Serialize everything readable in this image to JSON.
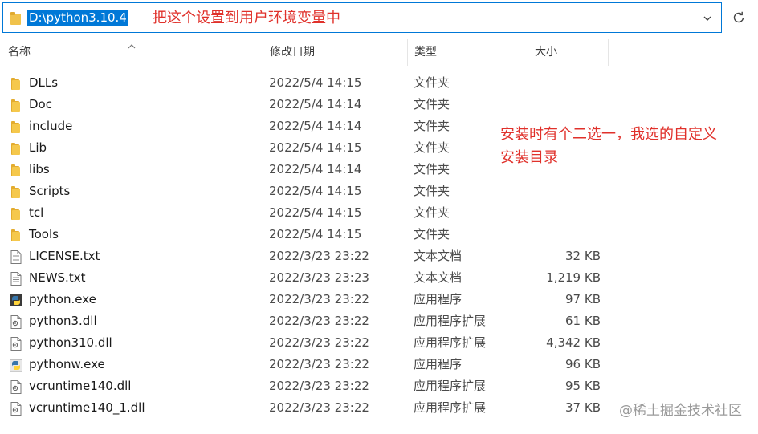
{
  "address": {
    "path": "D:\\python3.10.4"
  },
  "annotations": {
    "top": "把这个设置到用户环境变量中",
    "side_line1": "安装时有个二选一，我选的自定义",
    "side_line2": "安装目录"
  },
  "columns": {
    "name": "名称",
    "date": "修改日期",
    "type": "类型",
    "size": "大小"
  },
  "files": [
    {
      "name": "DLLs",
      "date": "2022/5/4 14:15",
      "type": "文件夹",
      "size": "",
      "icon": "folder-icon"
    },
    {
      "name": "Doc",
      "date": "2022/5/4 14:14",
      "type": "文件夹",
      "size": "",
      "icon": "folder-icon"
    },
    {
      "name": "include",
      "date": "2022/5/4 14:14",
      "type": "文件夹",
      "size": "",
      "icon": "folder-icon"
    },
    {
      "name": "Lib",
      "date": "2022/5/4 14:15",
      "type": "文件夹",
      "size": "",
      "icon": "folder-icon"
    },
    {
      "name": "libs",
      "date": "2022/5/4 14:14",
      "type": "文件夹",
      "size": "",
      "icon": "folder-icon"
    },
    {
      "name": "Scripts",
      "date": "2022/5/4 14:15",
      "type": "文件夹",
      "size": "",
      "icon": "folder-icon"
    },
    {
      "name": "tcl",
      "date": "2022/5/4 14:15",
      "type": "文件夹",
      "size": "",
      "icon": "folder-icon"
    },
    {
      "name": "Tools",
      "date": "2022/5/4 14:15",
      "type": "文件夹",
      "size": "",
      "icon": "folder-icon"
    },
    {
      "name": "LICENSE.txt",
      "date": "2022/3/23 23:22",
      "type": "文本文档",
      "size": "32 KB",
      "icon": "text-file-icon"
    },
    {
      "name": "NEWS.txt",
      "date": "2022/3/23 23:23",
      "type": "文本文档",
      "size": "1,219 KB",
      "icon": "text-file-icon"
    },
    {
      "name": "python.exe",
      "date": "2022/3/23 23:22",
      "type": "应用程序",
      "size": "97 KB",
      "icon": "python-exe-icon"
    },
    {
      "name": "python3.dll",
      "date": "2022/3/23 23:22",
      "type": "应用程序扩展",
      "size": "61 KB",
      "icon": "dll-file-icon"
    },
    {
      "name": "python310.dll",
      "date": "2022/3/23 23:22",
      "type": "应用程序扩展",
      "size": "4,342 KB",
      "icon": "dll-file-icon"
    },
    {
      "name": "pythonw.exe",
      "date": "2022/3/23 23:22",
      "type": "应用程序",
      "size": "96 KB",
      "icon": "pythonw-exe-icon"
    },
    {
      "name": "vcruntime140.dll",
      "date": "2022/3/23 23:22",
      "type": "应用程序扩展",
      "size": "95 KB",
      "icon": "dll-file-icon"
    },
    {
      "name": "vcruntime140_1.dll",
      "date": "2022/3/23 23:22",
      "type": "应用程序扩展",
      "size": "37 KB",
      "icon": "dll-file-icon"
    }
  ],
  "watermark": "@稀土掘金技术社区",
  "colors": {
    "accent": "#0078d7",
    "annotation": "#e0312b",
    "folder": "#f0c24b"
  }
}
